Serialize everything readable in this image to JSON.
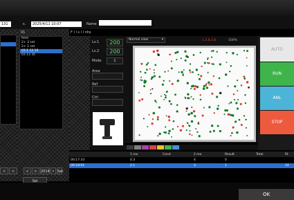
{
  "header": {
    "ref_label": "131",
    "date_prefix": "s.",
    "date_value": "2025/4/11 10:07",
    "name_label": "Name",
    "name_value": ""
  },
  "left_panel": {
    "tag": "",
    "buttons": [
      "<",
      "<"
    ]
  },
  "middle_panel": {
    "label": "01",
    "items": [
      "Item",
      "2+ 3 set",
      "2+ 1 set",
      "03.1 12.10",
      "03 13 35"
    ],
    "selected_index": 3,
    "buttons": [
      "<",
      ">",
      "2014",
      "•",
      "Set",
      "Sel"
    ]
  },
  "toolbar": {
    "title": "F l l  s l l  nhs"
  },
  "params": {
    "value1_label": "Lv.1",
    "value1": "200",
    "value2_label": "Lv.2",
    "value2": "200",
    "mode_label": "Mode",
    "mode_value": "1",
    "field_a_label": "Area",
    "field_b_label": "Ref",
    "field_c_label": "Ctrl"
  },
  "image_panel": {
    "dropdown": "Normal view",
    "status": "1.3.8.2.8",
    "zoom": "100%"
  },
  "color_swatches": [
    "#3a3a3a",
    "#7e7e7e",
    "#a646a6",
    "#d64646",
    "#e8c03a",
    "#46b446",
    "#4a8fd6"
  ],
  "right_buttons": [
    {
      "label": "AUTO",
      "color": "#e8e8e8",
      "text_color": "#999"
    },
    {
      "label": "RUN",
      "color": "#3fb44a",
      "text_color": "#fff"
    },
    {
      "label": "ANL",
      "color": "#4cb4d6",
      "text_color": "#fff"
    },
    {
      "label": "STOP",
      "color": "#ee5a3e",
      "text_color": "#fff"
    }
  ],
  "table": {
    "headers": [
      "",
      "",
      "1 mo",
      "Cond",
      "2 mo",
      "Result",
      "Total",
      "Rt"
    ],
    "rows": [
      [
        "00:17:33",
        "",
        "0.3",
        "",
        "4",
        "0",
        "",
        ""
      ],
      [
        "00:18:01",
        "",
        "2.1",
        "",
        "3",
        "1",
        "",
        "14"
      ]
    ],
    "selected_index": 1
  },
  "footer": {
    "button": "OK"
  }
}
